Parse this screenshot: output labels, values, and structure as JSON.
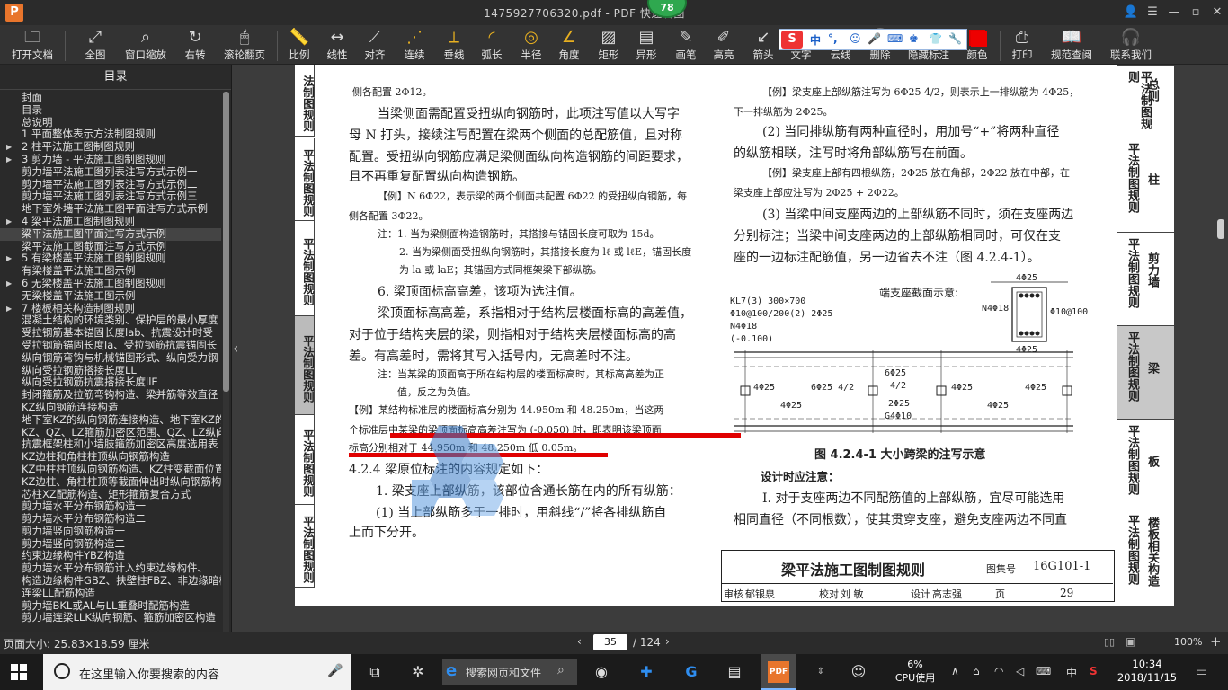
{
  "window": {
    "logo": "P",
    "title": "1475927706320.pdf - PDF 快速看图",
    "badge": "78"
  },
  "toolbar": {
    "items": [
      "打开文档",
      "全图",
      "窗口缩放",
      "右转",
      "滚轮翻页",
      "比例",
      "线性",
      "对齐",
      "连续",
      "垂线",
      "弧长",
      "半径",
      "角度",
      "矩形",
      "异形",
      "画笔",
      "高亮",
      "箭头",
      "文字",
      "云线",
      "删除",
      "隐藏标注",
      "颜色",
      "打印",
      "规范查阅",
      "联系我们"
    ]
  },
  "ime": {
    "logo": "S",
    "lang": "中"
  },
  "sidebar": {
    "title": "目录",
    "items": [
      {
        "label": "封面",
        "arrow": false,
        "selected": false
      },
      {
        "label": "目录",
        "arrow": false,
        "selected": false
      },
      {
        "label": "总说明",
        "arrow": false,
        "selected": false
      },
      {
        "label": "1 平面整体表示方法制图规则",
        "arrow": false,
        "selected": false
      },
      {
        "label": "2 柱平法施工图制图规则",
        "arrow": true,
        "selected": false
      },
      {
        "label": "3 剪力墙 - 平法施工图制图规则",
        "arrow": true,
        "selected": false
      },
      {
        "label": "剪力墙平法施工图列表注写方式示例一",
        "arrow": false,
        "selected": false
      },
      {
        "label": "剪力墙平法施工图列表注写方式示例二",
        "arrow": false,
        "selected": false
      },
      {
        "label": "剪力墙平法施工图列表注写方式示例三",
        "arrow": false,
        "selected": false
      },
      {
        "label": "地下室外墙平法施工图平面注写方式示例",
        "arrow": false,
        "selected": false
      },
      {
        "label": "4 梁平法施工图制图规则",
        "arrow": true,
        "selected": false
      },
      {
        "label": "梁平法施工图平面注写方式示例",
        "arrow": false,
        "selected": true
      },
      {
        "label": "梁平法施工图截面注写方式示例",
        "arrow": false,
        "selected": false
      },
      {
        "label": "5 有梁楼盖平法施工图制图规则",
        "arrow": true,
        "selected": false
      },
      {
        "label": "有梁楼盖平法施工图示例",
        "arrow": false,
        "selected": false
      },
      {
        "label": "6 无梁楼盖平法施工图制图规则",
        "arrow": true,
        "selected": false
      },
      {
        "label": "无梁楼盖平法施工图示例",
        "arrow": false,
        "selected": false
      },
      {
        "label": "7 楼板相关构造制图规则",
        "arrow": true,
        "selected": false
      },
      {
        "label": "混凝土结构的环境类别、保护层的最小厚度",
        "arrow": false,
        "selected": false
      },
      {
        "label": "受拉钢筋基本锚固长度lab、抗震设计时受",
        "arrow": false,
        "selected": false
      },
      {
        "label": "受拉钢筋锚固长度la、受拉钢筋抗震锚固长",
        "arrow": false,
        "selected": false
      },
      {
        "label": "纵向钢筋弯钩与机械锚固形式、纵向受力钢",
        "arrow": false,
        "selected": false
      },
      {
        "label": "纵向受拉钢筋搭接长度LL",
        "arrow": false,
        "selected": false
      },
      {
        "label": "纵向受拉钢筋抗震搭接长度llE",
        "arrow": false,
        "selected": false
      },
      {
        "label": "封闭箍筋及拉筋弯钩构造、梁并筋等效直径",
        "arrow": false,
        "selected": false
      },
      {
        "label": "KZ纵向钢筋连接构造",
        "arrow": false,
        "selected": false
      },
      {
        "label": "地下室KZ的纵向钢筋连接构造、地下室KZ的",
        "arrow": false,
        "selected": false
      },
      {
        "label": "KZ、QZ、LZ箍筋加密区范围、QZ、LZ纵向钢",
        "arrow": false,
        "selected": false
      },
      {
        "label": "抗震框架柱和小墙肢箍筋加密区高度选用表",
        "arrow": false,
        "selected": false
      },
      {
        "label": "KZ边柱和角柱柱顶纵向钢筋构造",
        "arrow": false,
        "selected": false
      },
      {
        "label": "KZ中柱柱顶纵向钢筋构造、KZ柱变截面位置",
        "arrow": false,
        "selected": false
      },
      {
        "label": "KZ边柱、角柱柱顶等截面伸出时纵向钢筋构",
        "arrow": false,
        "selected": false
      },
      {
        "label": "芯柱XZ配筋构造、矩形箍筋复合方式",
        "arrow": false,
        "selected": false
      },
      {
        "label": "剪力墙水平分布钢筋构造一",
        "arrow": false,
        "selected": false
      },
      {
        "label": "剪力墙水平分布钢筋构造二",
        "arrow": false,
        "selected": false
      },
      {
        "label": "剪力墙竖向钢筋构造一",
        "arrow": false,
        "selected": false
      },
      {
        "label": "剪力墙竖向钢筋构造二",
        "arrow": false,
        "selected": false
      },
      {
        "label": "约束边缘构件YBZ构造",
        "arrow": false,
        "selected": false
      },
      {
        "label": "剪力墙水平分布钢筋计入约束边缘构件、",
        "arrow": false,
        "selected": false
      },
      {
        "label": "构造边缘构件GBZ、扶壁柱FBZ、非边缘暗柱",
        "arrow": false,
        "selected": false
      },
      {
        "label": "连梁LL配筋构造",
        "arrow": false,
        "selected": false
      },
      {
        "label": "剪力墙BKL或AL与LL重叠时配筋构造",
        "arrow": false,
        "selected": false
      },
      {
        "label": "剪力墙连梁LLK纵向钢筋、箍筋加密区构造",
        "arrow": false,
        "selected": false
      }
    ]
  },
  "page": {
    "left_tabs": [
      {
        "label": "法制图规则",
        "active": false
      },
      {
        "label": "平法制图规则",
        "active": false
      },
      {
        "label": "平法制图规则",
        "active": false
      },
      {
        "label": "平法制图规则",
        "active": true
      },
      {
        "label": "平法制图规则",
        "active": false
      },
      {
        "label": "平法制图规则",
        "active": false
      }
    ],
    "right_tabs": [
      {
        "v": "平法制图规则",
        "s": "总则",
        "active": false
      },
      {
        "v": "平法制图规则",
        "s": "柱",
        "active": false
      },
      {
        "v": "平法制图规则",
        "s": "剪力墙",
        "active": false
      },
      {
        "v": "平法制图规则",
        "s": "梁",
        "active": true
      },
      {
        "v": "平法制图规则",
        "s": "板",
        "active": false
      },
      {
        "v": "平法制图规则",
        "s": "楼板相关构造",
        "active": false
      }
    ],
    "left_lines": [
      {
        "t": "侧各配置 2Φ12。",
        "cls": "sm"
      },
      {
        "t": "当梁侧面需配置受扭纵向钢筋时，此项注写值以大写字",
        "cls": ""
      },
      {
        "t": "母 N 打头，接续注写配置在梁两个侧面的总配筋值，且对称",
        "cls": ""
      },
      {
        "t": "配置。受扭纵向钢筋应满足梁侧面纵向构造钢筋的间距要求，",
        "cls": ""
      },
      {
        "t": "且不再重复配置纵向构造钢筋。",
        "cls": ""
      },
      {
        "t": "【例】N 6Φ22，表示梁的两个侧面共配置 6Φ22 的受扭纵向钢筋，每",
        "cls": "sm"
      },
      {
        "t": "侧各配置 3Φ22。",
        "cls": "sm"
      },
      {
        "t": "注：1. 当为梁侧面构造钢筋时，其搭接与锚固长度可取为 15d。",
        "cls": "sm"
      },
      {
        "t": "2. 当为梁侧面受扭纵向钢筋时，其搭接长度为 lℓ 或 lℓE，锚固长度",
        "cls": "sm"
      },
      {
        "t": "为 la 或 laE；其锚固方式同框架梁下部纵筋。",
        "cls": "sm"
      },
      {
        "t": "6. 梁顶面标高高差，该项为选注值。",
        "cls": ""
      },
      {
        "t": "梁顶面标高高差，系指相对于结构层楼面标高的高差值，",
        "cls": ""
      },
      {
        "t": "对于位于结构夹层的梁，则指相对于结构夹层楼面标高的高",
        "cls": ""
      },
      {
        "t": "差。有高差时，需将其写入括号内，无高差时不注。",
        "cls": ""
      },
      {
        "t": "注：当某梁的顶面高于所在结构层的楼面标高时，其标高高差为正",
        "cls": "sm"
      },
      {
        "t": "值，反之为负值。",
        "cls": "sm"
      },
      {
        "t": "【例】某结构标准层的楼面标高分别为 44.950m 和 48.250m，当这两",
        "cls": "sm"
      },
      {
        "t": "个标准层中某梁的梁顶面标高高差注写为 (-0.050) 时，即表明该梁顶面",
        "cls": "sm"
      },
      {
        "t": "标高分别相对于 44.950m 和 48.250m 低 0.05m。",
        "cls": "sm"
      },
      {
        "t": "4.2.4  梁原位标注的内容规定如下：",
        "cls": ""
      },
      {
        "t": "1. 梁支座上部纵筋，该部位含通长筋在内的所有纵筋：",
        "cls": ""
      },
      {
        "t": "(1) 当上部纵筋多于一排时，用斜线“/”将各排纵筋自",
        "cls": ""
      },
      {
        "t": "上而下分开。",
        "cls": ""
      }
    ],
    "right_lines": [
      {
        "t": "【例】梁支座上部纵筋注写为 6Φ25 4/2，则表示上一排纵筋为 4Φ25，",
        "cls": "sm"
      },
      {
        "t": "下一排纵筋为 2Φ25。",
        "cls": "sm"
      },
      {
        "t": "(2) 当同排纵筋有两种直径时，用加号“+”将两种直径",
        "cls": ""
      },
      {
        "t": "的纵筋相联，注写时将角部纵筋写在前面。",
        "cls": ""
      },
      {
        "t": "【例】梁支座上部有四根纵筋，2Φ25 放在角部，2Φ22 放在中部，在",
        "cls": "sm"
      },
      {
        "t": "梁支座上部应注写为 2Φ25 + 2Φ22。",
        "cls": "sm"
      },
      {
        "t": "(3) 当梁中间支座两边的上部纵筋不同时，须在支座两边",
        "cls": ""
      },
      {
        "t": "分别标注；当梁中间支座两边的上部纵筋相同时，可仅在支",
        "cls": ""
      },
      {
        "t": "座的一边标注配筋值，另一边省去不注（图 4.2.4-1）。",
        "cls": ""
      }
    ],
    "figure": {
      "beam_label": [
        "KL7(3)  300×700",
        "Φ10@100/200(2)  2Φ25",
        "N4Φ18",
        "(-0.100)"
      ],
      "section_title": "端支座截面示意:",
      "sec_top": "4Φ25",
      "sec_side": "N4Φ18",
      "sec_stirrup": "Φ10@100",
      "sec_bottom": "4Φ25",
      "spans": [
        "4Φ25",
        "6Φ25  4/2",
        "6Φ25",
        "4/2",
        "4Φ25",
        "4Φ25",
        "4Φ25",
        "2Φ25",
        "G4Φ10",
        "4Φ25"
      ],
      "caption": "图 4.2.4-1  大小跨梁的注写示意"
    },
    "design_note_title": "设计时应注意：",
    "design_note_lines": [
      "Ⅰ. 对于支座两边不同配筋值的上部纵筋，宜尽可能选用",
      "相同直径（不同根数），使其贯穿支座，避免支座两边不同直"
    ],
    "title_block": {
      "title": "梁平法施工图制图规则",
      "atlas_label": "图集号",
      "atlas_no": "16G101-1",
      "review": "审核",
      "reviewer": "郁银泉",
      "check": "校对",
      "checker": "刘  敏",
      "design": "设计",
      "designer": "高志强",
      "page_label": "页",
      "page_no": "29"
    }
  },
  "statusbar": {
    "page_size": "页面大小: 25.83×18.59 厘米",
    "current_page": "35",
    "total_pages": "/ 124",
    "zoom": "100%"
  },
  "taskbar": {
    "search_placeholder": "在这里输入你要搜索的内容",
    "web_search": "搜索网页和文件",
    "pdf_label": "PDF",
    "cpu_percent": "6%",
    "cpu_label": "CPU使用",
    "ime_lang": "中",
    "time": "10:34",
    "date": "2018/11/15"
  },
  "colors": {
    "accent": "#e8752c",
    "highlight_red": "#e00000",
    "badge_green": "#2fa84f"
  }
}
